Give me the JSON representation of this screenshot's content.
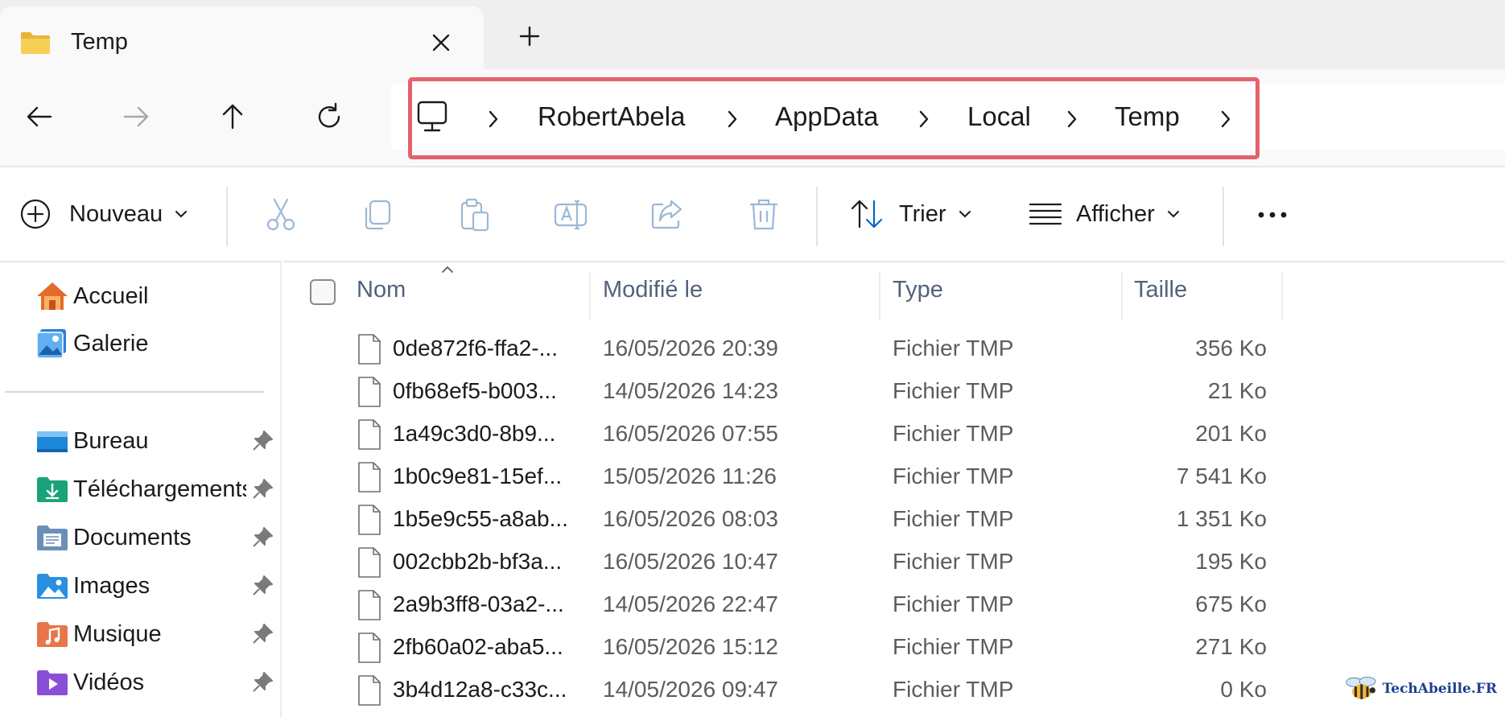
{
  "tab": {
    "title": "Temp"
  },
  "navigation": {
    "breadcrumb": [
      {
        "label": "RobertAbela"
      },
      {
        "label": "AppData"
      },
      {
        "label": "Local"
      },
      {
        "label": "Temp"
      }
    ]
  },
  "commands": {
    "new_label": "Nouveau",
    "sort_label": "Trier",
    "view_label": "Afficher"
  },
  "sidebar": {
    "quick": [
      {
        "label": "Accueil",
        "icon": "home-icon"
      },
      {
        "label": "Galerie",
        "icon": "gallery-icon"
      }
    ],
    "pinned": [
      {
        "label": "Bureau",
        "icon": "desktop-folder-icon"
      },
      {
        "label": "Téléchargements",
        "icon": "downloads-folder-icon"
      },
      {
        "label": "Documents",
        "icon": "documents-folder-icon"
      },
      {
        "label": "Images",
        "icon": "pictures-folder-icon"
      },
      {
        "label": "Musique",
        "icon": "music-folder-icon"
      },
      {
        "label": "Vidéos",
        "icon": "videos-folder-icon"
      }
    ]
  },
  "filelist": {
    "columns": {
      "name": "Nom",
      "modified": "Modifié le",
      "type": "Type",
      "size": "Taille"
    },
    "rows": [
      {
        "name": "0de872f6-ffa2-...",
        "modified": "16/05/2026 20:39",
        "type": "Fichier TMP",
        "size": "356 Ko"
      },
      {
        "name": "0fb68ef5-b003...",
        "modified": "14/05/2026 14:23",
        "type": "Fichier TMP",
        "size": "21 Ko"
      },
      {
        "name": "1a49c3d0-8b9...",
        "modified": "16/05/2026 07:55",
        "type": "Fichier TMP",
        "size": "201 Ko"
      },
      {
        "name": "1b0c9e81-15ef...",
        "modified": "15/05/2026 11:26",
        "type": "Fichier TMP",
        "size": "7 541 Ko"
      },
      {
        "name": "1b5e9c55-a8ab...",
        "modified": "16/05/2026 08:03",
        "type": "Fichier TMP",
        "size": "1 351 Ko"
      },
      {
        "name": "002cbb2b-bf3a...",
        "modified": "16/05/2026 10:47",
        "type": "Fichier TMP",
        "size": "195 Ko"
      },
      {
        "name": "2a9b3ff8-03a2-...",
        "modified": "14/05/2026 22:47",
        "type": "Fichier TMP",
        "size": "675 Ko"
      },
      {
        "name": "2fb60a02-aba5...",
        "modified": "16/05/2026 15:12",
        "type": "Fichier TMP",
        "size": "271 Ko"
      },
      {
        "name": "3b4d12a8-c33c...",
        "modified": "14/05/2026 09:47",
        "type": "Fichier TMP",
        "size": "0 Ko"
      }
    ]
  },
  "watermark": {
    "text": "TechAbeille.FR"
  },
  "colors": {
    "highlight": "#e5616c",
    "accent": "#0067c0",
    "folder": "#f4c542"
  }
}
